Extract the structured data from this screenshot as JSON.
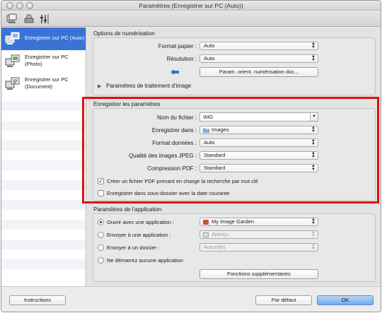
{
  "window": {
    "title": "Paramètres (Enregistrer sur PC (Auto))"
  },
  "toolbar": {
    "icons": [
      "scan-from-pc-icon",
      "scan-from-panel-icon",
      "general-settings-icon"
    ]
  },
  "sidebar": {
    "items": [
      {
        "label": "Enregistrer sur PC (Auto)",
        "selected": true,
        "icon": "save-to-pc-auto-icon"
      },
      {
        "label": "Enregistrer sur PC (Photo)",
        "selected": false,
        "icon": "save-to-pc-photo-icon"
      },
      {
        "label": "Enregistrer sur PC (Document)",
        "selected": false,
        "icon": "save-to-pc-document-icon"
      }
    ]
  },
  "scan_options": {
    "title": "Options de numérisation",
    "paper_size_label": "Format papier :",
    "paper_size_value": "Auto",
    "resolution_label": "Résolution :",
    "resolution_value": "Auto",
    "orientation_button": "Param. orient. numérisation doc...",
    "image_processing_label": "Paramètres de traitement d'image"
  },
  "save_settings": {
    "title": "Enregistrer les paramètres",
    "file_name_label": "Nom du fichier :",
    "file_name_value": "IMG",
    "save_in_label": "Enregistrer dans :",
    "save_in_value": "Images",
    "data_format_label": "Format données :",
    "data_format_value": "Auto",
    "jpeg_quality_label": "Qualité des images JPEG :",
    "jpeg_quality_value": "Standard",
    "pdf_compression_label": "Compression PDF :",
    "pdf_compression_value": "Standard",
    "keyword_pdf_label": "Créer un fichier PDF prenant en charge la recherche par mot clé",
    "keyword_pdf_checked": true,
    "subfolder_label": "Enregistrer dans sous-dossier avec la date courante",
    "subfolder_checked": false
  },
  "app_settings": {
    "title": "Paramètres de l'application",
    "open_app_label": "Ouvrir avec une application :",
    "open_app_value": "My Image Garden",
    "send_app_label": "Envoyer à une application :",
    "send_app_value": "Aperçu",
    "send_folder_label": "Envoyer à un dossier :",
    "send_folder_value": "Aucun(e)",
    "no_app_label": "Ne démarrez aucune application",
    "selected_option": "open_app",
    "more_functions_button": "Fonctions supplémentaires"
  },
  "footer": {
    "instructions_button": "Instructions",
    "defaults_button": "Par défaut",
    "ok_button": "OK"
  },
  "colors": {
    "selection": "#3a73d6",
    "highlight": "#e01010",
    "default_button": "#72a9ee"
  }
}
